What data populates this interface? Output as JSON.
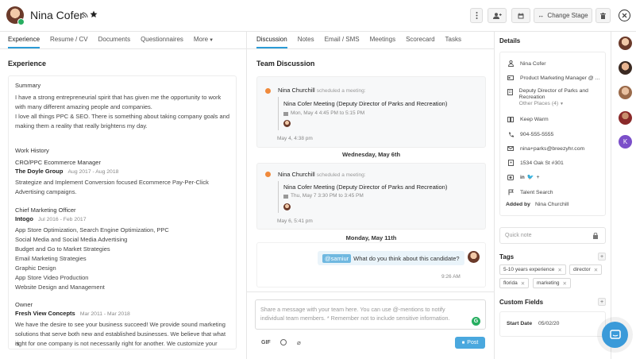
{
  "header": {
    "name": "Nina Cofer",
    "rss_icon": "rss-icon",
    "star_icon": "star-icon",
    "change_stage_label": "Change Stage"
  },
  "left_tabs": [
    "Experience",
    "Resume / CV",
    "Documents",
    "Questionnaires",
    "More"
  ],
  "experience": {
    "title": "Experience",
    "summary_heading": "Summary",
    "summary_lines": [
      "I have a strong entrepreneurial spirit that has given me the opportunity to work",
      "with many different amazing people and companies.",
      "I love all things PPC & SEO. There is something about taking company goals and",
      "making them a reality that really brightens my day."
    ],
    "work_history_heading": "Work History",
    "jobs": [
      {
        "title": "CRO/PPC Ecommerce Manager",
        "company": "The Doyle Group",
        "dates": "Aug 2017 - Aug 2018",
        "lines": [
          "Strategize and Implement Conversion focused Ecommerce Pay-Per-Click",
          "Advertising campaigns."
        ]
      },
      {
        "title": "Chief Marketing Officer",
        "company": "Intogo",
        "dates": "Jul 2016 - Feb 2017",
        "lines": [
          "App Store Optimization, Search Engine Optimization, PPC",
          "Social Media and Social Media Advertising",
          "Budget and Go to Market Strategies",
          "Email Marketing Strategies",
          "Graphic Design",
          "App Store Video Production",
          "Website Design and Management"
        ]
      },
      {
        "title": "Owner",
        "company": "Fresh View Concepts",
        "dates": "Mar 2011 - Mar 2018",
        "lines": [
          "We have the desire to see your business succeed! We provide sound marketing",
          "solutions that serve both new and established businesses. We believe that what is",
          "right for one company is not necessarily right for another. We customize your"
        ]
      }
    ]
  },
  "middle_tabs": [
    "Discussion",
    "Notes",
    "Email / SMS",
    "Meetings",
    "Scorecard",
    "Tasks"
  ],
  "discussion": {
    "title": "Team Discussion",
    "meetings": [
      {
        "author": "Nina Churchill",
        "action": "scheduled a meeting:",
        "meeting_title": "Nina Cofer Meeting (Deputy Director of Parks and Recreation)",
        "meeting_time": "Mon, May 4 4:45 PM to 5:15 PM",
        "posted": "May 4, 4:38 pm"
      },
      {
        "author": "Nina Churchill",
        "action": "scheduled a meeting:",
        "meeting_title": "Nina Cofer Meeting (Deputy Director of Parks and Recreation)",
        "meeting_time": "Thu, May 7 3:30 PM to 3:45 PM",
        "posted": "May 6, 5:41 pm"
      }
    ],
    "date_separators": [
      "Wednesday, May 6th",
      "Monday, May 11th"
    ],
    "message": {
      "mention": "@samiur",
      "text": "What do you think about this candidate?",
      "time": "9:26 AM"
    },
    "composer": {
      "placeholder": "Share a message with your team here. You can use @-mentions to notify individual team members. * Remember not to include sensitive information.",
      "gif_label": "GIF",
      "post_label": "Post"
    }
  },
  "details": {
    "title": "Details",
    "name": "Nina Cofer",
    "position": "Product Marketing Manager @ ...",
    "place": "Deputy Director of Parks and Recreation",
    "other_places": "Other Places (4)",
    "temperature": "Keep Warm",
    "phone": "904-555-5555",
    "email": "nina+parks@breezyhr.com",
    "address": "1534 Oak St #301",
    "source": "Talent Search",
    "added_by_label": "Added by",
    "added_by": "Nina Churchill",
    "quick_note_placeholder": "Quick note",
    "tags_title": "Tags",
    "tags": [
      "5-10 years experience",
      "director",
      "florida",
      "marketing"
    ],
    "custom_fields_title": "Custom Fields",
    "start_date_label": "Start Date",
    "start_date": "05/02/20"
  },
  "side_avatars": [
    "avatar-1",
    "avatar-2",
    "avatar-3",
    "avatar-4",
    "K"
  ],
  "colors": {
    "accent": "#2a9bd6",
    "orange": "#f08a3c",
    "green": "#27ae60",
    "purple": "#7b4fc9",
    "mention_bg": "#e8f4fb"
  }
}
